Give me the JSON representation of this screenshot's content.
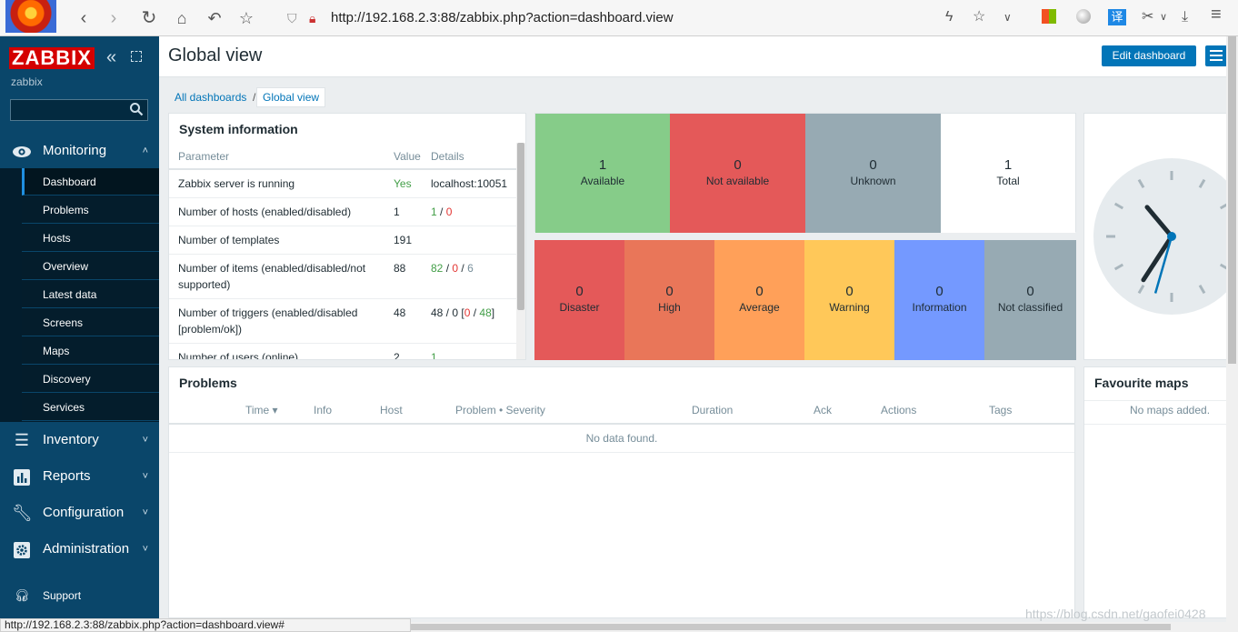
{
  "browser": {
    "url": "http://192.168.2.3:88/zabbix.php?action=dashboard.view",
    "status_url": "http://192.168.2.3:88/zabbix.php?action=dashboard.view#",
    "translate_label": "译"
  },
  "sidebar": {
    "logo": "ZABBIX",
    "server_name": "zabbix",
    "search_placeholder": "",
    "monitoring": {
      "label": "Monitoring",
      "items": [
        {
          "label": "Dashboard",
          "active": true
        },
        {
          "label": "Problems"
        },
        {
          "label": "Hosts"
        },
        {
          "label": "Overview"
        },
        {
          "label": "Latest data"
        },
        {
          "label": "Screens"
        },
        {
          "label": "Maps"
        },
        {
          "label": "Discovery"
        },
        {
          "label": "Services"
        }
      ]
    },
    "sections": [
      {
        "label": "Inventory",
        "icon": "list-icon"
      },
      {
        "label": "Reports",
        "icon": "bar-chart-icon"
      },
      {
        "label": "Configuration",
        "icon": "wrench-icon"
      },
      {
        "label": "Administration",
        "icon": "gear-icon"
      }
    ],
    "support": "Support"
  },
  "header": {
    "title": "Global view",
    "edit_button": "Edit dashboard"
  },
  "breadcrumb": {
    "all": "All dashboards",
    "separator": "/",
    "current": "Global view"
  },
  "system_info": {
    "title": "System information",
    "columns": [
      "Parameter",
      "Value",
      "Details"
    ],
    "rows": [
      {
        "param": "Zabbix server is running",
        "value": "Yes",
        "details": "localhost:10051"
      },
      {
        "param": "Number of hosts (enabled/disabled)",
        "value": "1",
        "details_parts": [
          "1",
          " / ",
          "0"
        ]
      },
      {
        "param": "Number of templates",
        "value": "191",
        "details": ""
      },
      {
        "param_lines": [
          "Number of items (enabled/disabled/not",
          "supported)"
        ],
        "value": "88",
        "details_parts": [
          "82",
          " / ",
          "0",
          " / ",
          "6"
        ]
      },
      {
        "param_lines": [
          "Number of triggers (enabled/disabled",
          "[problem/ok])"
        ],
        "value": "48",
        "details_parts": [
          "48 / 0 [",
          "0",
          " / ",
          "48",
          "]"
        ]
      },
      {
        "param": "Number of users (online)",
        "value": "2",
        "details": "1"
      }
    ]
  },
  "host_availability": [
    {
      "count": "1",
      "label": "Available",
      "color": "#86cc89"
    },
    {
      "count": "0",
      "label": "Not available",
      "color": "#e45959"
    },
    {
      "count": "0",
      "label": "Unknown",
      "color": "#97aab3"
    },
    {
      "count": "1",
      "label": "Total",
      "color": "#ffffff"
    }
  ],
  "problem_severity": [
    {
      "count": "0",
      "label": "Disaster",
      "color": "#e45959"
    },
    {
      "count": "0",
      "label": "High",
      "color": "#e97659"
    },
    {
      "count": "0",
      "label": "Average",
      "color": "#ffa059"
    },
    {
      "count": "0",
      "label": "Warning",
      "color": "#ffc859"
    },
    {
      "count": "0",
      "label": "Information",
      "color": "#7499ff"
    },
    {
      "count": "0",
      "label": "Not classified",
      "color": "#97aab3"
    }
  ],
  "clock": {
    "hour_angle": 320,
    "minute_angle": 213,
    "second_angle": 196
  },
  "problems": {
    "title": "Problems",
    "columns": [
      "Time ▾",
      "Info",
      "Host",
      "Problem • Severity",
      "Duration",
      "Ack",
      "Actions",
      "Tags"
    ],
    "empty": "No data found."
  },
  "favourite_maps": {
    "title": "Favourite maps",
    "empty": "No maps added."
  },
  "watermark": "https://blog.csdn.net/gaofei0428"
}
